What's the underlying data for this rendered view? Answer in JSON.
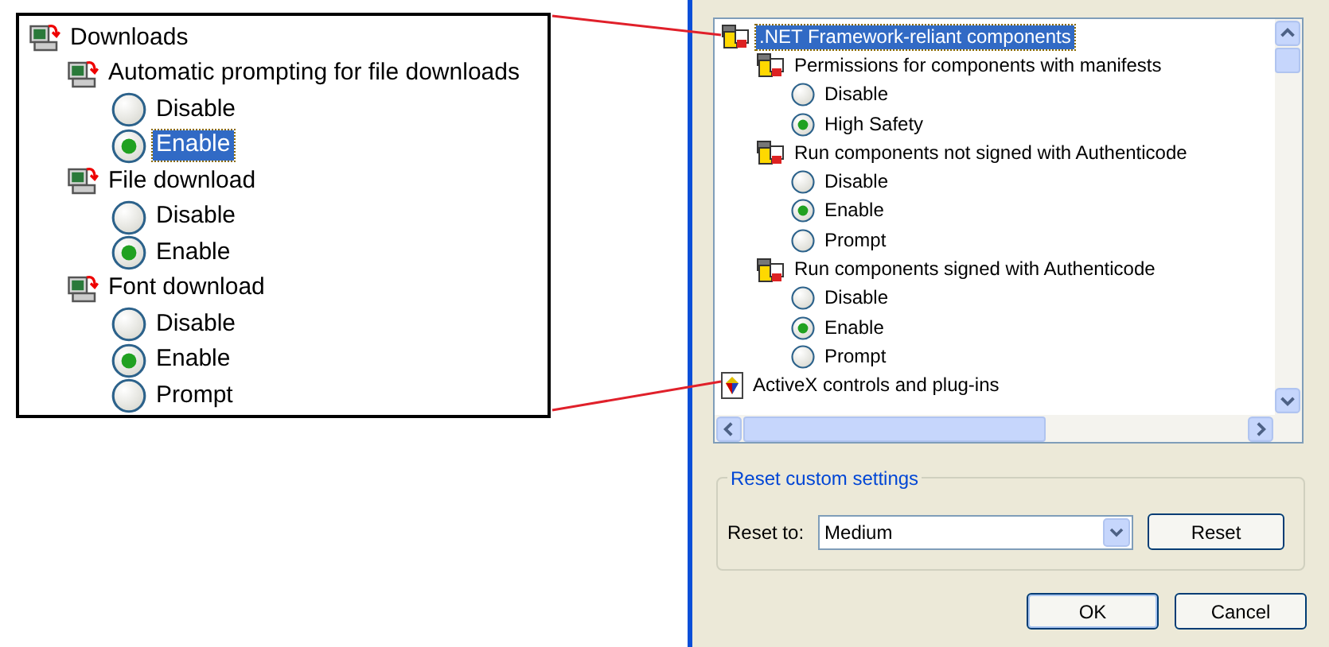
{
  "callout": {
    "tree": [
      {
        "label": "Downloads",
        "kind": "category",
        "selected": false,
        "children": [
          {
            "label": "Automatic prompting for file downloads",
            "kind": "setting",
            "selected": false,
            "children": [
              {
                "label": "Disable",
                "kind": "option",
                "checked": false,
                "selected": false
              },
              {
                "label": "Enable",
                "kind": "option",
                "checked": true,
                "selected": true
              }
            ]
          },
          {
            "label": "File download",
            "kind": "setting",
            "selected": false,
            "children": [
              {
                "label": "Disable",
                "kind": "option",
                "checked": false,
                "selected": false
              },
              {
                "label": "Enable",
                "kind": "option",
                "checked": true,
                "selected": false
              }
            ]
          },
          {
            "label": "Font download",
            "kind": "setting",
            "selected": false,
            "children": [
              {
                "label": "Disable",
                "kind": "option",
                "checked": false,
                "selected": false
              },
              {
                "label": "Enable",
                "kind": "option",
                "checked": true,
                "selected": false
              },
              {
                "label": "Prompt",
                "kind": "option",
                "checked": false,
                "selected": false
              }
            ]
          }
        ]
      }
    ]
  },
  "settings": {
    "tree": [
      {
        "label": ".NET Framework-reliant components",
        "kind": "category",
        "selected": true,
        "children": [
          {
            "label": "Permissions for components with manifests",
            "kind": "setting",
            "selected": false,
            "children": [
              {
                "label": "Disable",
                "kind": "option",
                "checked": false,
                "selected": false
              },
              {
                "label": "High Safety",
                "kind": "option",
                "checked": true,
                "selected": false
              }
            ]
          },
          {
            "label": "Run components not signed with Authenticode",
            "kind": "setting",
            "selected": false,
            "children": [
              {
                "label": "Disable",
                "kind": "option",
                "checked": false,
                "selected": false
              },
              {
                "label": "Enable",
                "kind": "option",
                "checked": true,
                "selected": false
              },
              {
                "label": "Prompt",
                "kind": "option",
                "checked": false,
                "selected": false
              }
            ]
          },
          {
            "label": "Run components signed with Authenticode",
            "kind": "setting",
            "selected": false,
            "children": [
              {
                "label": "Disable",
                "kind": "option",
                "checked": false,
                "selected": false
              },
              {
                "label": "Enable",
                "kind": "option",
                "checked": true,
                "selected": false
              },
              {
                "label": "Prompt",
                "kind": "option",
                "checked": false,
                "selected": false
              }
            ]
          }
        ]
      },
      {
        "label": "ActiveX controls and plug-ins",
        "kind": "category",
        "selected": false
      }
    ]
  },
  "reset_group": {
    "title": "Reset custom settings",
    "label": "Reset to:",
    "value": "Medium",
    "button": "Reset"
  },
  "buttons": [
    "OK",
    "Cancel"
  ]
}
